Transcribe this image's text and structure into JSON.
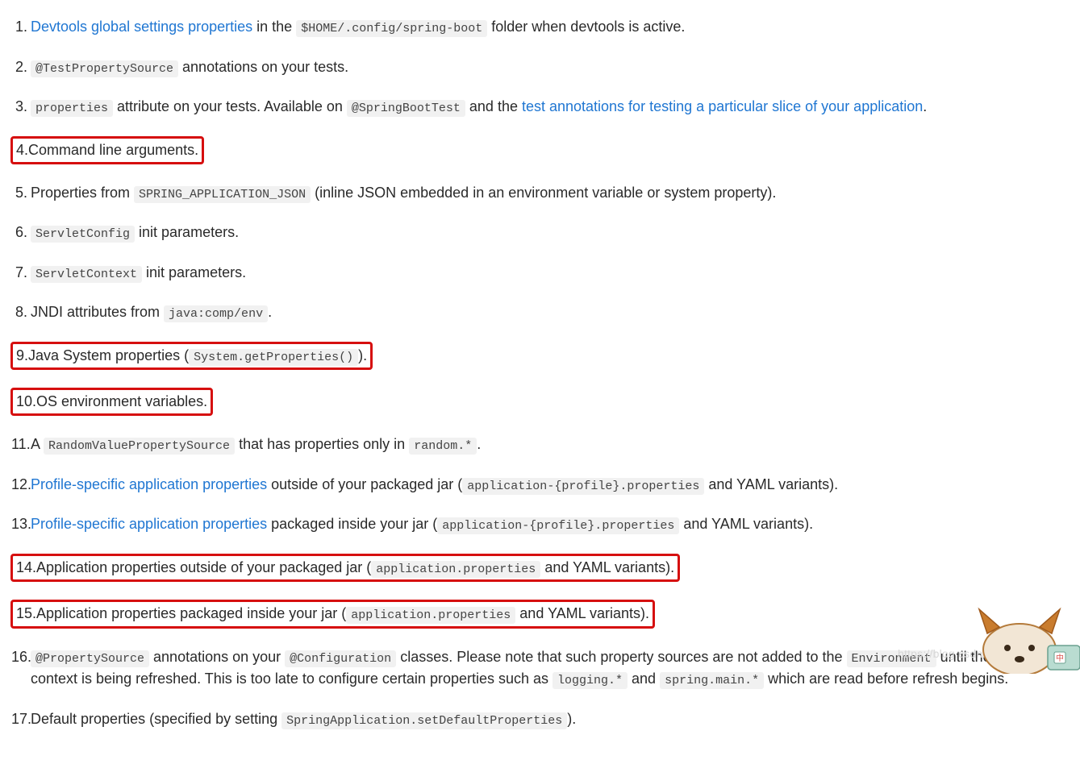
{
  "list": {
    "items": [
      {
        "parts": [
          {
            "t": "link",
            "v": "Devtools global settings properties"
          },
          {
            "t": "text",
            "v": " in the "
          },
          {
            "t": "code",
            "v": "$HOME/.config/spring-boot"
          },
          {
            "t": "text",
            "v": " folder when devtools is active."
          }
        ],
        "boxed": false
      },
      {
        "parts": [
          {
            "t": "code",
            "v": "@TestPropertySource"
          },
          {
            "t": "text",
            "v": " annotations on your tests."
          }
        ],
        "boxed": false
      },
      {
        "parts": [
          {
            "t": "code",
            "v": "properties"
          },
          {
            "t": "text",
            "v": " attribute on your tests. Available on "
          },
          {
            "t": "code",
            "v": "@SpringBootTest"
          },
          {
            "t": "text",
            "v": " and the "
          },
          {
            "t": "link",
            "v": "test annotations for testing a particular slice of your application"
          },
          {
            "t": "text",
            "v": "."
          }
        ],
        "boxed": false
      },
      {
        "parts": [
          {
            "t": "text",
            "v": "Command line arguments."
          }
        ],
        "boxed": true
      },
      {
        "parts": [
          {
            "t": "text",
            "v": "Properties from "
          },
          {
            "t": "code",
            "v": "SPRING_APPLICATION_JSON"
          },
          {
            "t": "text",
            "v": " (inline JSON embedded in an environment variable or system property)."
          }
        ],
        "boxed": false
      },
      {
        "parts": [
          {
            "t": "code",
            "v": "ServletConfig"
          },
          {
            "t": "text",
            "v": " init parameters."
          }
        ],
        "boxed": false
      },
      {
        "parts": [
          {
            "t": "code",
            "v": "ServletContext"
          },
          {
            "t": "text",
            "v": " init parameters."
          }
        ],
        "boxed": false
      },
      {
        "parts": [
          {
            "t": "text",
            "v": "JNDI attributes from "
          },
          {
            "t": "code",
            "v": "java:comp/env"
          },
          {
            "t": "text",
            "v": "."
          }
        ],
        "boxed": false
      },
      {
        "parts": [
          {
            "t": "text",
            "v": "Java System properties ("
          },
          {
            "t": "code",
            "v": "System.getProperties()"
          },
          {
            "t": "text",
            "v": ")."
          }
        ],
        "boxed": true
      },
      {
        "parts": [
          {
            "t": "text",
            "v": "OS environment variables."
          }
        ],
        "boxed": true
      },
      {
        "parts": [
          {
            "t": "text",
            "v": "A "
          },
          {
            "t": "code",
            "v": "RandomValuePropertySource"
          },
          {
            "t": "text",
            "v": " that has properties only in "
          },
          {
            "t": "code",
            "v": "random.*"
          },
          {
            "t": "text",
            "v": "."
          }
        ],
        "boxed": false
      },
      {
        "parts": [
          {
            "t": "link",
            "v": "Profile-specific application properties"
          },
          {
            "t": "text",
            "v": " outside of your packaged jar ("
          },
          {
            "t": "code",
            "v": "application-{profile}.properties"
          },
          {
            "t": "text",
            "v": " and YAML variants)."
          }
        ],
        "boxed": false
      },
      {
        "parts": [
          {
            "t": "link",
            "v": "Profile-specific application properties"
          },
          {
            "t": "text",
            "v": " packaged inside your jar ("
          },
          {
            "t": "code",
            "v": "application-{profile}.properties"
          },
          {
            "t": "text",
            "v": " and YAML variants)."
          }
        ],
        "boxed": false
      },
      {
        "parts": [
          {
            "t": "text",
            "v": "Application properties outside of your packaged jar ("
          },
          {
            "t": "code",
            "v": "application.properties"
          },
          {
            "t": "text",
            "v": " and YAML variants)."
          }
        ],
        "boxed": true
      },
      {
        "parts": [
          {
            "t": "text",
            "v": "Application properties packaged inside your jar ("
          },
          {
            "t": "code",
            "v": "application.properties"
          },
          {
            "t": "text",
            "v": " and YAML variants)."
          }
        ],
        "boxed": true
      },
      {
        "parts": [
          {
            "t": "code",
            "v": "@PropertySource"
          },
          {
            "t": "text",
            "v": " annotations on your "
          },
          {
            "t": "code",
            "v": "@Configuration"
          },
          {
            "t": "text",
            "v": " classes. Please note that such property sources are not added to the "
          },
          {
            "t": "code",
            "v": "Environment"
          },
          {
            "t": "text",
            "v": " until the application context is being refreshed. This is too late to configure certain properties such as "
          },
          {
            "t": "code",
            "v": "logging.*"
          },
          {
            "t": "text",
            "v": " and "
          },
          {
            "t": "code",
            "v": "spring.main.*"
          },
          {
            "t": "text",
            "v": " which are read before refresh begins."
          }
        ],
        "boxed": false
      },
      {
        "parts": [
          {
            "t": "text",
            "v": "Default properties (specified by setting "
          },
          {
            "t": "code",
            "v": "SpringApplication.setDefaultProperties"
          },
          {
            "t": "text",
            "v": ")."
          }
        ],
        "boxed": false
      }
    ]
  },
  "watermark": "https://blog.csdn.net/mythal"
}
